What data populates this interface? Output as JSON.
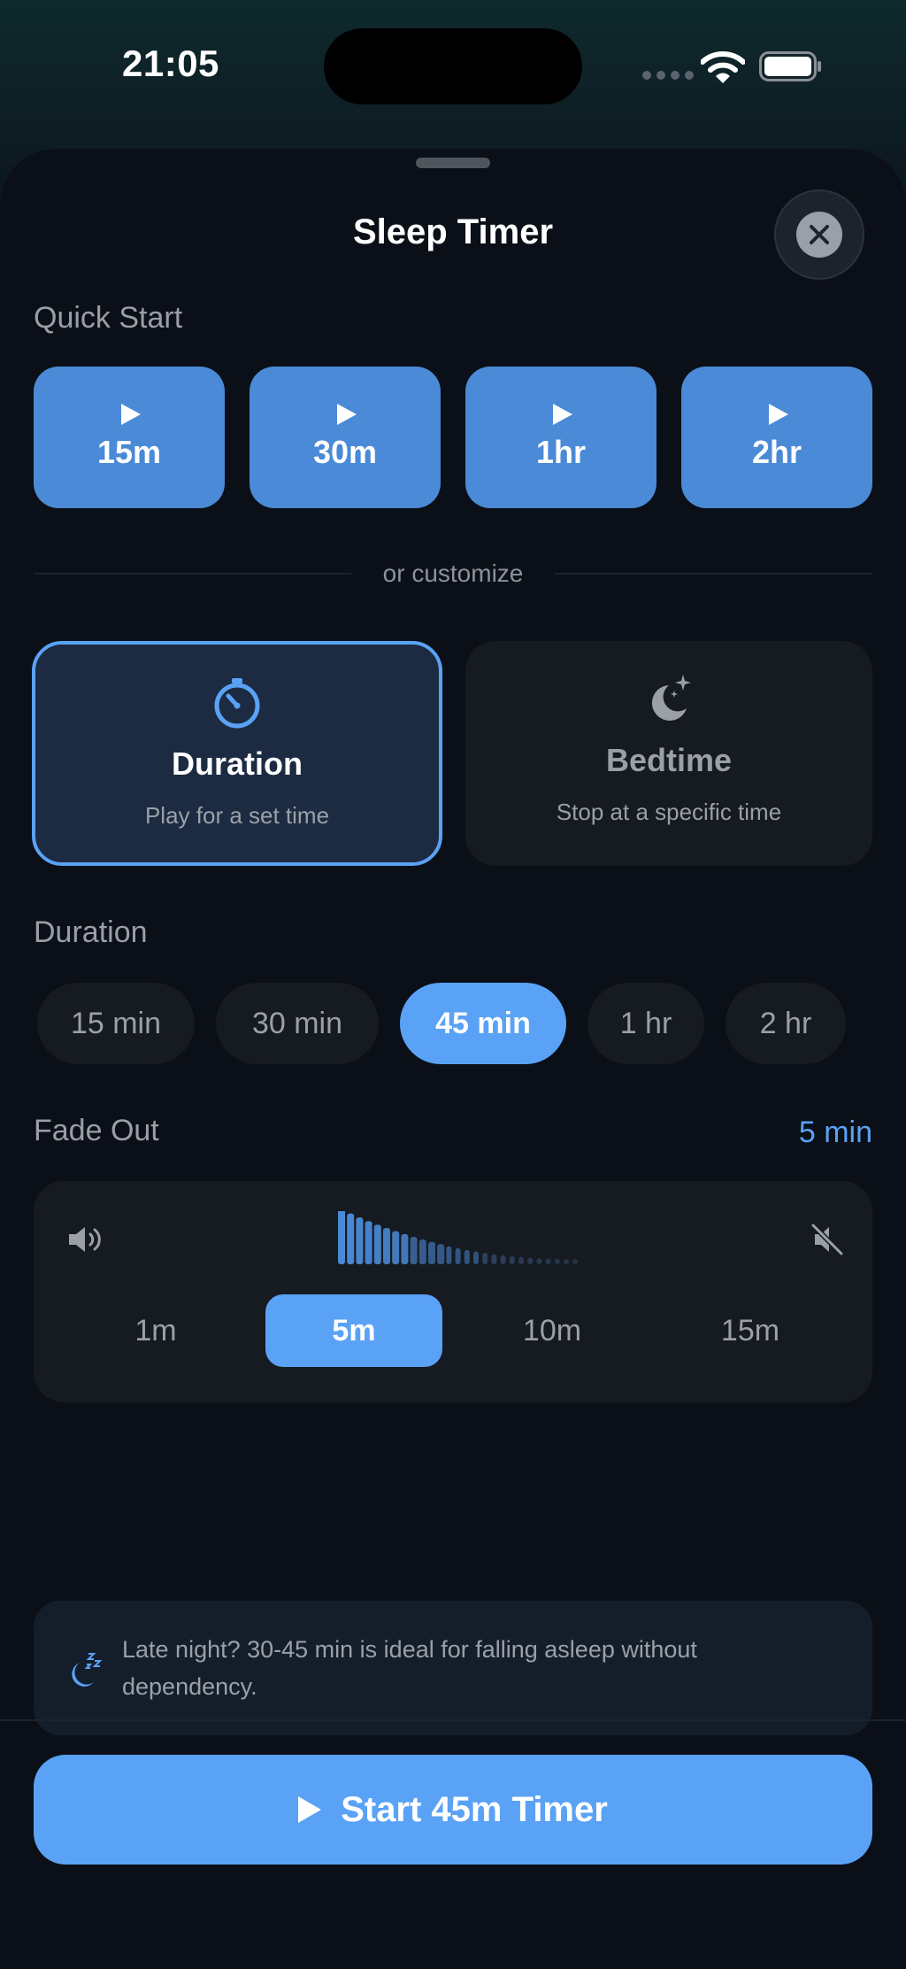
{
  "status_bar": {
    "time": "21:05"
  },
  "sheet": {
    "title": "Sleep Timer",
    "quick_start": {
      "label": "Quick Start",
      "buttons": [
        "15m",
        "30m",
        "1hr",
        "2hr"
      ]
    },
    "divider_text": "or customize",
    "modes": [
      {
        "title": "Duration",
        "subtitle": "Play for a set time",
        "icon": "stopwatch-icon",
        "selected": true
      },
      {
        "title": "Bedtime",
        "subtitle": "Stop at a specific time",
        "icon": "moon-stars-icon",
        "selected": false
      }
    ],
    "duration": {
      "label": "Duration",
      "options": [
        "15 min",
        "30 min",
        "45 min",
        "1 hr",
        "2 hr"
      ],
      "selected": "45 min"
    },
    "fade_out": {
      "label": "Fade Out",
      "value": "5 min",
      "options": [
        "1m",
        "5m",
        "10m",
        "15m"
      ],
      "selected": "5m"
    },
    "tip": {
      "icon": "moon-zzz-icon",
      "text": "Late night? 30-45 min is ideal for falling asleep without dependency."
    },
    "start_button": "Start 45m Timer"
  },
  "colors": {
    "accent": "#5aa2f5",
    "quick_start": "#4a8ad6",
    "card": "#161a21",
    "background": "#0b0f17"
  }
}
